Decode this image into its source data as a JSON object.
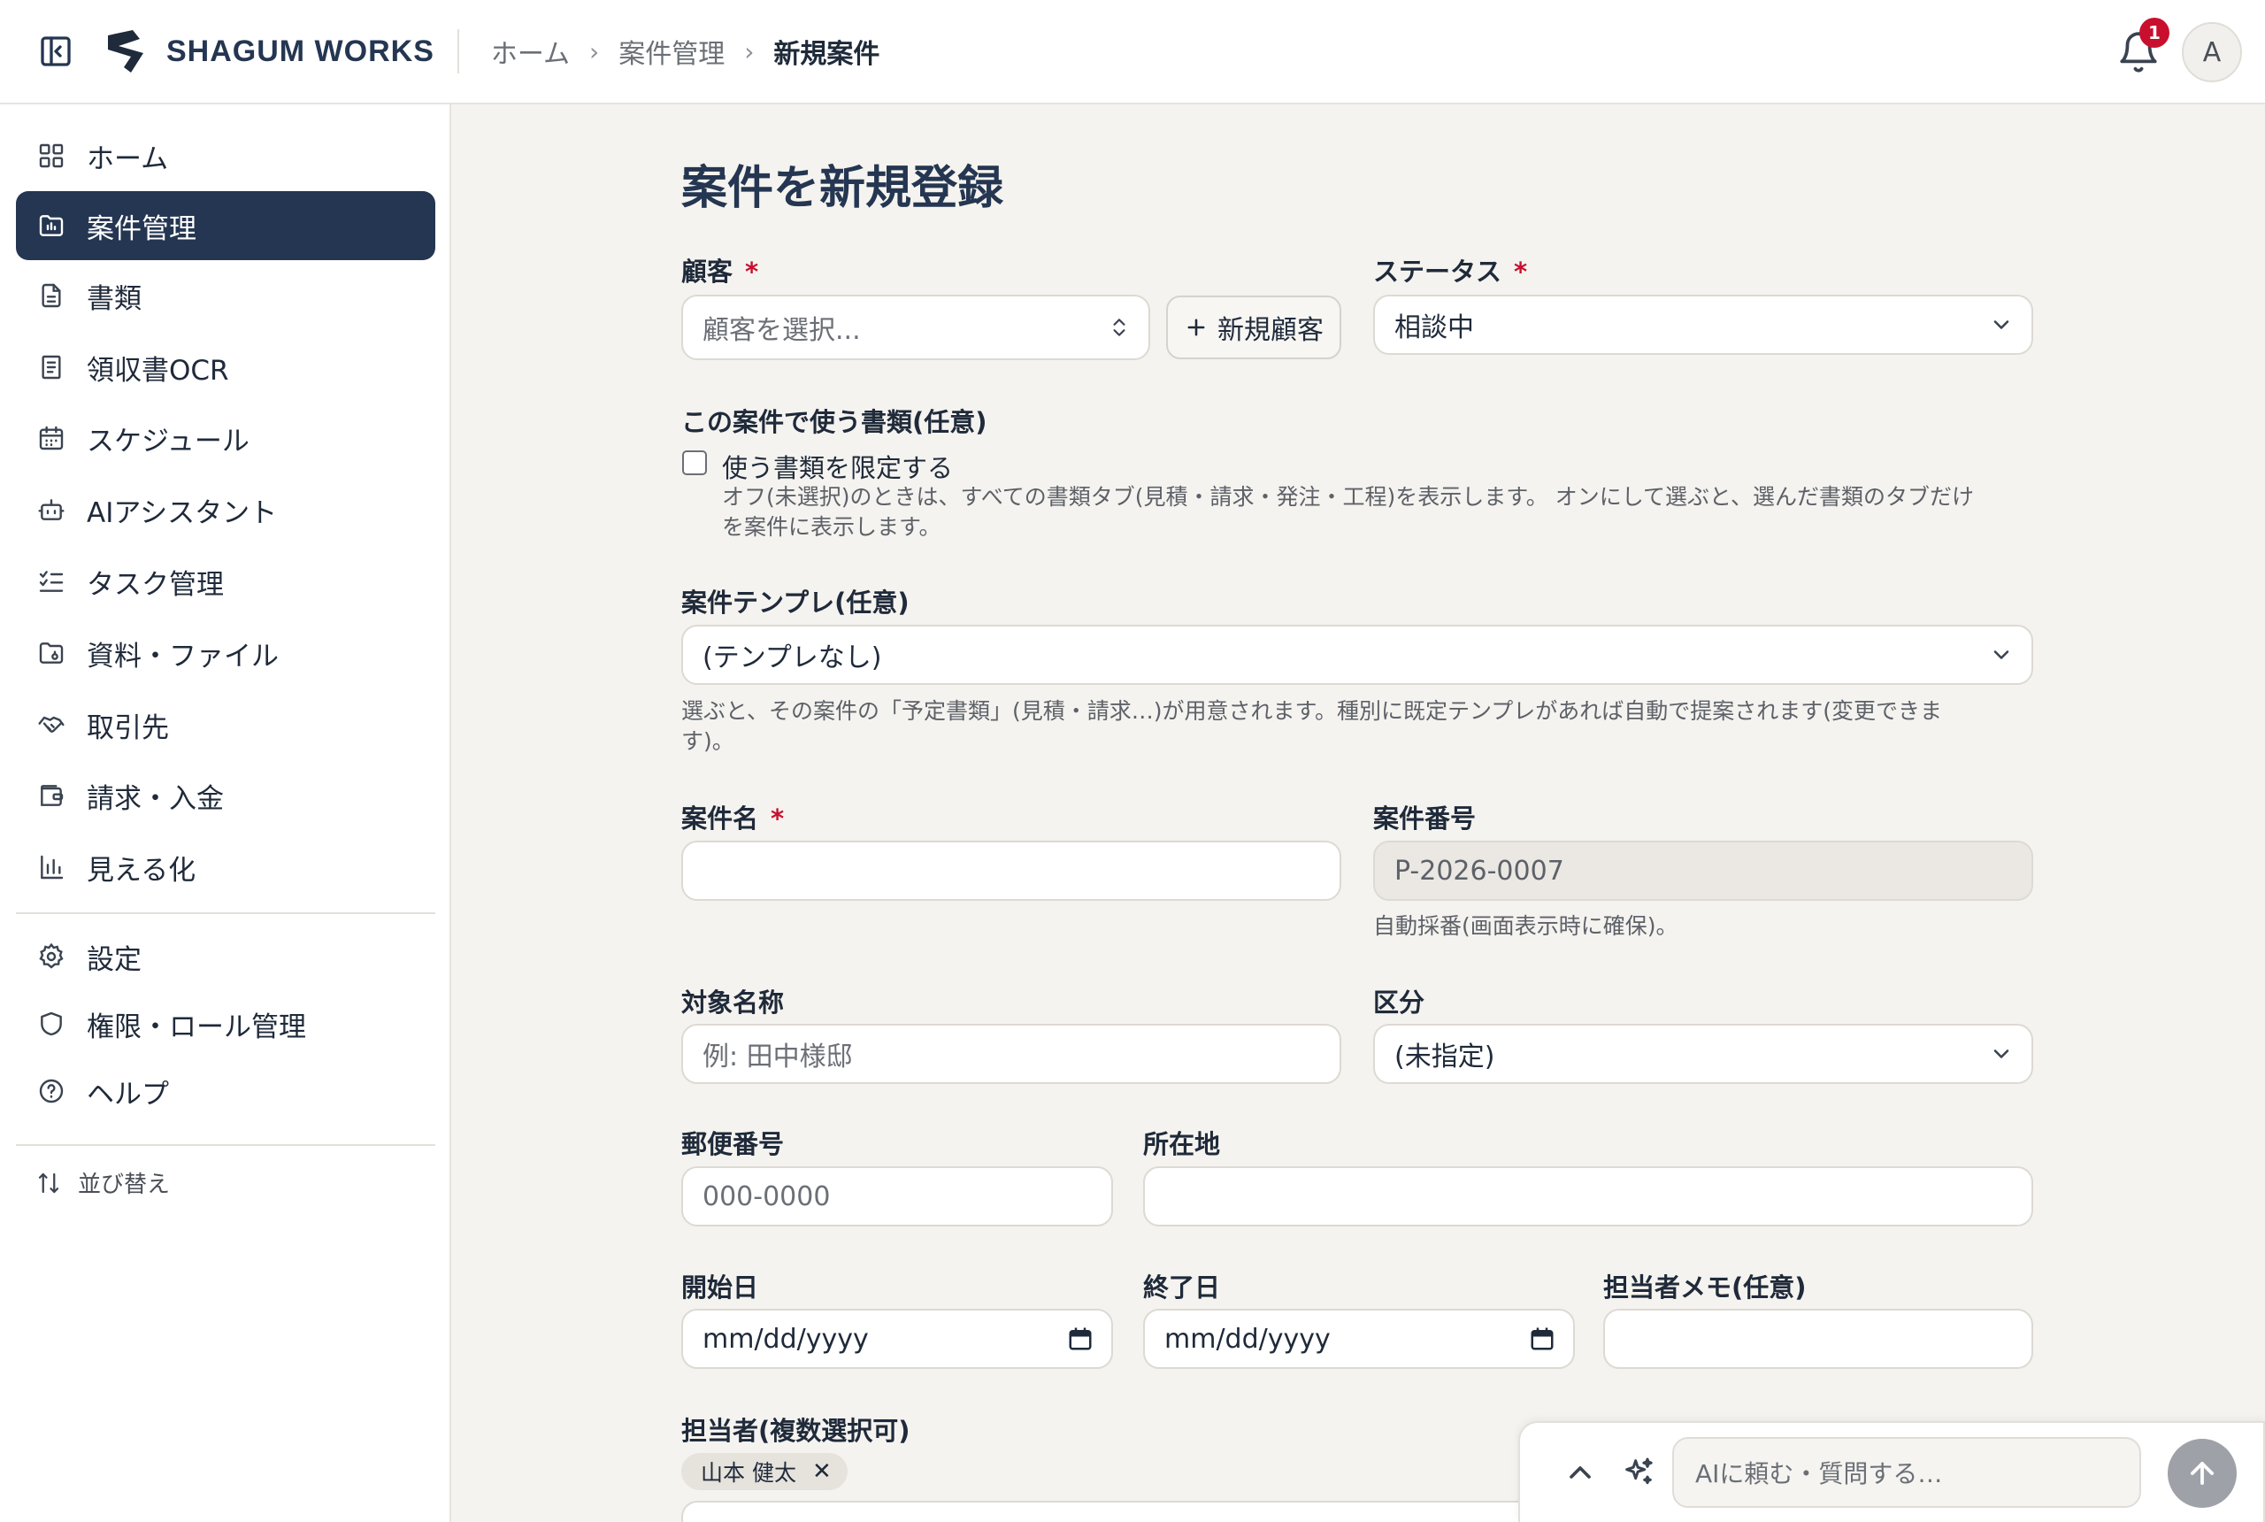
{
  "brand": {
    "name": "SHAGUM WORKS"
  },
  "breadcrumb": {
    "home": "ホーム",
    "projects": "案件管理",
    "current": "新規案件",
    "sep": "›"
  },
  "header": {
    "notification_count": "1",
    "avatar_initial": "A"
  },
  "sidebar": {
    "items": [
      {
        "label": "ホーム",
        "icon": "grid-icon"
      },
      {
        "label": "案件管理",
        "icon": "folder-chart-icon",
        "active": true
      },
      {
        "label": "書類",
        "icon": "document-icon"
      },
      {
        "label": "領収書OCR",
        "icon": "receipt-icon"
      },
      {
        "label": "スケジュール",
        "icon": "calendar-icon"
      },
      {
        "label": "AIアシスタント",
        "icon": "bot-icon"
      },
      {
        "label": "タスク管理",
        "icon": "checklist-icon"
      },
      {
        "label": "資料・ファイル",
        "icon": "folder-icon"
      },
      {
        "label": "取引先",
        "icon": "handshake-icon"
      },
      {
        "label": "請求・入金",
        "icon": "wallet-icon"
      },
      {
        "label": "見える化",
        "icon": "bar-chart-icon"
      }
    ],
    "bottom_items": [
      {
        "label": "設定",
        "icon": "gear-icon"
      },
      {
        "label": "権限・ロール管理",
        "icon": "shield-icon"
      },
      {
        "label": "ヘルプ",
        "icon": "help-icon"
      }
    ],
    "sort_label": "並び替え"
  },
  "form": {
    "title": "案件を新規登録",
    "required_mark": "*",
    "customer": {
      "label": "顧客",
      "placeholder": "顧客を選択...",
      "new_button": "新規顧客"
    },
    "status": {
      "label": "ステータス",
      "value": "相談中"
    },
    "documents": {
      "label": "この案件で使う書類(任意)",
      "checkbox_label": "使う書類を限定する",
      "help_line1": "オフ(未選択)のときは、すべての書類タブ(見積・請求・発注・工程)を表示します。 オンにして選ぶと、選んだ書類のタブだけ",
      "help_line2": "を案件に表示します。"
    },
    "template": {
      "label": "案件テンプレ(任意)",
      "value": "(テンプレなし)",
      "help_line1": "選ぶと、その案件の「予定書類」(見積・請求…)が用意されます。種別に既定テンプレがあれば自動で提案されます(変更できま",
      "help_line2": "す)。"
    },
    "project_name": {
      "label": "案件名",
      "value": ""
    },
    "project_number": {
      "label": "案件番号",
      "value": "P-2026-0007",
      "help": "自動採番(画面表示時に確保)。"
    },
    "target_name": {
      "label": "対象名称",
      "placeholder": "例: 田中様邸"
    },
    "category": {
      "label": "区分",
      "value": "(未指定)"
    },
    "postal": {
      "label": "郵便番号",
      "placeholder": "000-0000"
    },
    "address": {
      "label": "所在地",
      "value": ""
    },
    "start_date": {
      "label": "開始日",
      "placeholder": "mm/dd/yyyy"
    },
    "end_date": {
      "label": "終了日",
      "placeholder": "mm/dd/yyyy"
    },
    "memo": {
      "label": "担当者メモ(任意)",
      "value": ""
    },
    "assignees": {
      "label": "担当者(複数選択可)",
      "chips": [
        "山本 健太"
      ]
    }
  },
  "ai_bar": {
    "placeholder": "AIに頼む・質問する…"
  }
}
